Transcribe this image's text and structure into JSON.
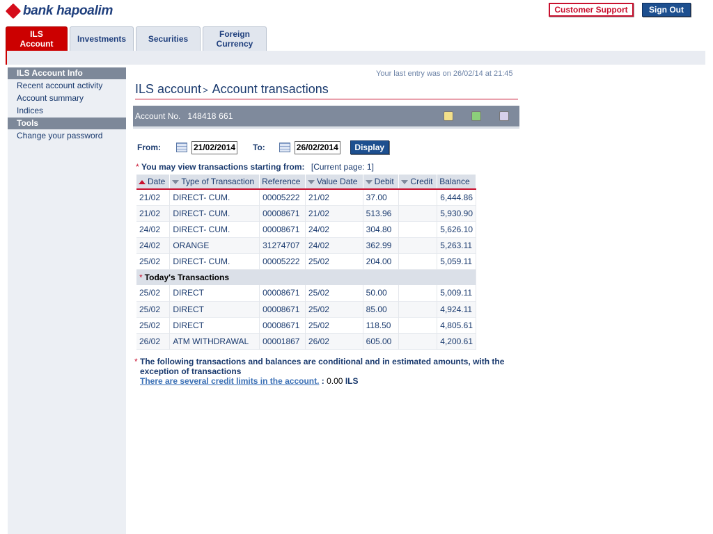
{
  "header": {
    "logo_text": "bank hapoalim",
    "support_label": "Customer Support",
    "signout_label": "Sign Out"
  },
  "tabs": [
    {
      "label_line1": "ILS",
      "label_line2": "Account",
      "active": true
    },
    {
      "label": "Investments"
    },
    {
      "label": "Securities"
    },
    {
      "label_line1": "Foreign",
      "label_line2": "Currency"
    }
  ],
  "sidebar": {
    "sections": [
      {
        "title": "ILS Account Info",
        "items": [
          "Recent account activity",
          "Account summary",
          "Indices"
        ]
      },
      {
        "title": "Tools",
        "items": [
          "Change your password"
        ]
      }
    ]
  },
  "main": {
    "last_entry": "Your last entry was on 26/02/14 at  21:45",
    "breadcrumb_parent": "ILS account",
    "breadcrumb_sep": ">",
    "title": "Account transactions",
    "account_label": "Account No.",
    "account_number": "148418 661",
    "icons": [
      "print-icon",
      "excel-icon",
      "calculator-icon"
    ],
    "from_label": "From:",
    "from_value": "21/02/2014",
    "to_label": "To:",
    "to_value": "26/02/2014",
    "display_label": "Display",
    "note_star": "*",
    "note_text": "You may view transactions starting from:",
    "current_page": "[Current page: 1]"
  },
  "table": {
    "headers": [
      "Date",
      "Type of Transaction",
      "Reference",
      "Value Date",
      "Debit",
      "Credit",
      "Balance"
    ],
    "rows": [
      [
        "21/02",
        "DIRECT- CUM.",
        "00005222",
        "21/02",
        "37.00",
        "",
        "6,444.86"
      ],
      [
        "21/02",
        "DIRECT- CUM.",
        "00008671",
        "21/02",
        "513.96",
        "",
        "5,930.90"
      ],
      [
        "24/02",
        "DIRECT- CUM.",
        "00008671",
        "24/02",
        "304.80",
        "",
        "5,626.10"
      ],
      [
        "24/02",
        "ORANGE",
        "31274707",
        "24/02",
        "362.99",
        "",
        "5,263.11"
      ],
      [
        "25/02",
        "DIRECT- CUM.",
        "00005222",
        "25/02",
        "204.00",
        "",
        "5,059.11"
      ]
    ],
    "section_label": "Today's Transactions",
    "today_rows": [
      [
        "25/02",
        "DIRECT",
        "00008671",
        "25/02",
        "50.00",
        "",
        "5,009.11"
      ],
      [
        "25/02",
        "DIRECT",
        "00008671",
        "25/02",
        "85.00",
        "",
        "4,924.11"
      ],
      [
        "25/02",
        "DIRECT",
        "00008671",
        "25/02",
        "118.50",
        "",
        "4,805.61"
      ],
      [
        "26/02",
        "ATM WITHDRAWAL",
        "00001867",
        "26/02",
        "605.00",
        "",
        "4,200.61"
      ]
    ]
  },
  "footnote": {
    "line1": "The following transactions and balances are conditional and in estimated amounts, with the",
    "line2": "exception of transactions",
    "link_text": "There are several credit limits in the account.",
    "colon": ":",
    "credit_value": "0.00",
    "currency": "ILS"
  },
  "colors": {
    "brand_red": "#cc0000",
    "brand_blue": "#1d4f8f",
    "sidebar_head": "#7d8899"
  }
}
